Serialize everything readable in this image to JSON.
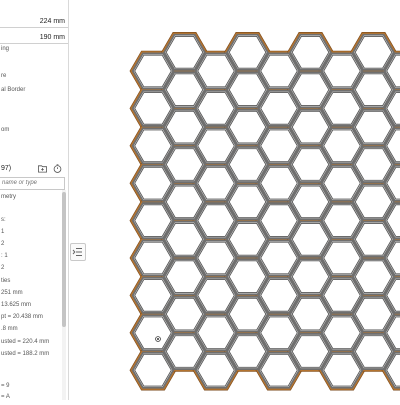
{
  "panel": {
    "width_value": "224 mm",
    "height_value": "190 mm",
    "options": [
      "ing",
      "re",
      "al Border",
      "",
      "om"
    ],
    "parameters_title": "97)",
    "search_placeholder": "name or type",
    "params": [
      "metry",
      "s:",
      "1",
      "2",
      ": 1",
      "2",
      "ties",
      "251 mm",
      "13.625 mm",
      "pt = 20.438 mm",
      ".8 mm",
      "usted = 220.4 mm",
      "usted = 188.2 mm",
      "= 9",
      "= A"
    ]
  },
  "grid": {
    "rows": 9,
    "cols": 9,
    "frame_color": "#b5742f",
    "cell_color": "#6f6f6f"
  }
}
